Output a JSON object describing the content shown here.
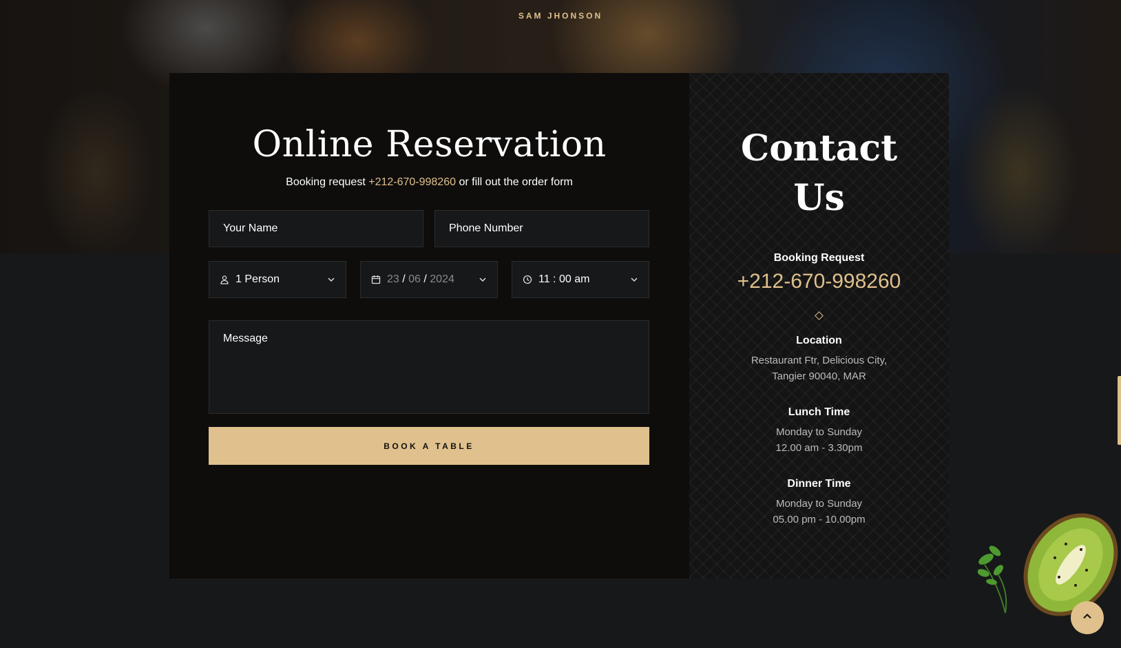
{
  "hero": {
    "name": "SAM JHONSON"
  },
  "reservation": {
    "title": "Online Reservation",
    "subtitle_prefix": "Booking request ",
    "phone": "+212-670-998260",
    "subtitle_suffix": " or fill out the order form",
    "name_placeholder": "Your Name",
    "phone_placeholder": "Phone Number",
    "persons": "1 Person",
    "date_day": "23",
    "date_month": "06",
    "date_year": "2024",
    "time": "11 : 00 am",
    "message_placeholder": "Message",
    "button_label": "BOOK A TABLE"
  },
  "contact": {
    "title_line1": "Contact",
    "title_line2": "Us",
    "booking_heading": "Booking Request",
    "booking_phone": "+212-670-998260",
    "location_heading": "Location",
    "location_line1": "Restaurant Ftr, Delicious City,",
    "location_line2": "Tangier 90040, MAR",
    "lunch_heading": "Lunch Time",
    "lunch_line1": "Monday to Sunday",
    "lunch_line2": "12.00 am - 3.30pm",
    "dinner_heading": "Dinner Time",
    "dinner_line1": "Monday to Sunday",
    "dinner_line2": "05.00 pm - 10.00pm"
  },
  "icons": {
    "person": "person-icon",
    "calendar": "calendar-icon",
    "clock": "clock-icon",
    "chevron": "chevron-down-icon",
    "scroll_top": "chevron-up-icon"
  },
  "colors": {
    "accent": "#e0c08c",
    "background": "#17181a",
    "card": "#0e0d0c"
  }
}
